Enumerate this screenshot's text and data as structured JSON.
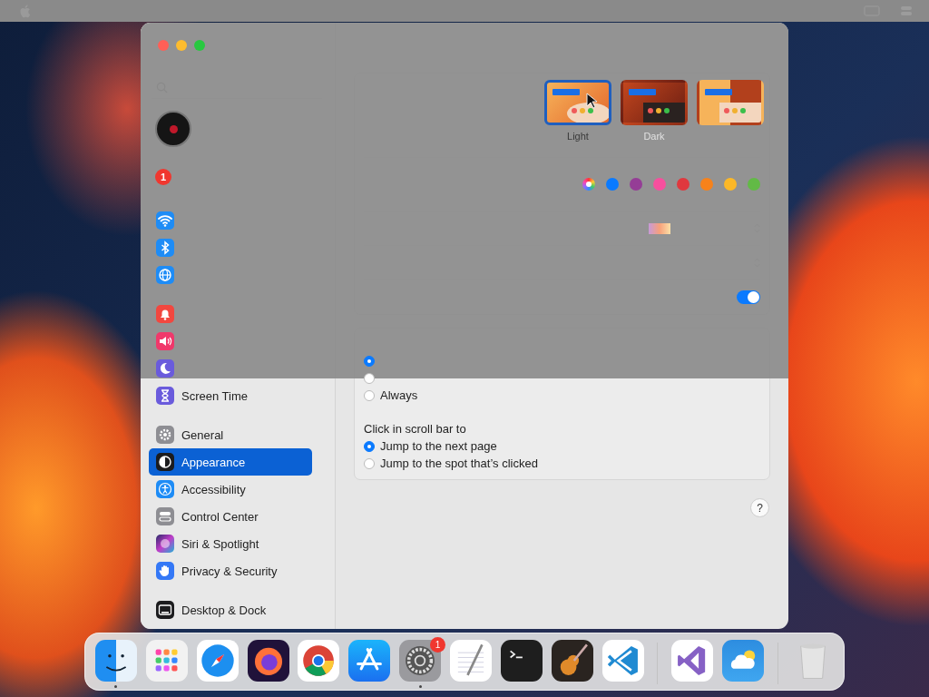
{
  "window": {
    "sidebar": {
      "account_notice": {
        "badge": "1"
      },
      "groups": [
        {
          "items": [
            {
              "kind": "wifi",
              "selected": false
            },
            {
              "kind": "bluetooth",
              "selected": false
            },
            {
              "kind": "network",
              "selected": false
            }
          ]
        },
        {
          "items": [
            {
              "kind": "notifications",
              "selected": false
            },
            {
              "kind": "sound",
              "selected": false
            },
            {
              "kind": "focus",
              "selected": false
            },
            {
              "kind": "screentime",
              "label": "Screen Time",
              "selected": false
            }
          ]
        },
        {
          "items": [
            {
              "kind": "general",
              "label": "General",
              "selected": false
            },
            {
              "kind": "appearance",
              "label": "Appearance",
              "selected": true
            },
            {
              "kind": "accessibility",
              "label": "Accessibility",
              "selected": false
            },
            {
              "kind": "controlcenter",
              "label": "Control Center",
              "selected": false
            },
            {
              "kind": "siri",
              "label": "Siri & Spotlight",
              "selected": false
            },
            {
              "kind": "privacy",
              "label": "Privacy & Security",
              "selected": false
            }
          ]
        },
        {
          "items": [
            {
              "kind": "desktop",
              "label": "Desktop & Dock",
              "selected": false
            }
          ]
        }
      ]
    },
    "appearance": {
      "options": [
        {
          "kind": "light",
          "label": "Light",
          "selected": true
        },
        {
          "kind": "dark",
          "label": "Dark",
          "selected": false
        },
        {
          "kind": "auto",
          "selected": false
        }
      ]
    },
    "accent": {
      "colors": [
        {
          "kind": "multicolor",
          "selected": true
        },
        {
          "color": "#0a7aff",
          "selected": false
        },
        {
          "color": "#953d96",
          "selected": false
        },
        {
          "color": "#f74f9e",
          "selected": false
        },
        {
          "color": "#e0383e",
          "selected": false
        },
        {
          "color": "#f7821b",
          "selected": false
        },
        {
          "color": "#fcb827",
          "selected": false
        },
        {
          "color": "#62ba46",
          "selected": false
        }
      ]
    },
    "wallpaper_tinting": {
      "on": true
    },
    "show_scroll_bars": {
      "options": [
        {
          "selected": true
        },
        {
          "selected": false
        },
        {
          "label": "Always",
          "selected": false
        }
      ]
    },
    "click_scroll_bar": {
      "label": "Click in scroll bar to",
      "options": [
        {
          "label": "Jump to the next page",
          "selected": true
        },
        {
          "label": "Jump to the spot that’s clicked",
          "selected": false
        }
      ]
    },
    "help": "?"
  },
  "dock": {
    "apps": [
      {
        "kind": "finder",
        "running": true
      },
      {
        "kind": "launchpad",
        "running": false
      },
      {
        "kind": "safari",
        "running": false
      },
      {
        "kind": "firefox",
        "running": false
      },
      {
        "kind": "chrome",
        "running": false
      },
      {
        "kind": "appstore",
        "running": false
      },
      {
        "kind": "settings",
        "running": true,
        "badge": "1"
      },
      {
        "kind": "textedit",
        "running": false
      },
      {
        "kind": "terminal",
        "running": false
      },
      {
        "kind": "garageband",
        "running": false
      },
      {
        "kind": "vscode",
        "running": false,
        "separator_after": true
      },
      {
        "kind": "visualstudio",
        "running": false
      },
      {
        "kind": "weather",
        "running": false,
        "separator_after": true
      },
      {
        "kind": "trash",
        "running": false
      }
    ]
  }
}
